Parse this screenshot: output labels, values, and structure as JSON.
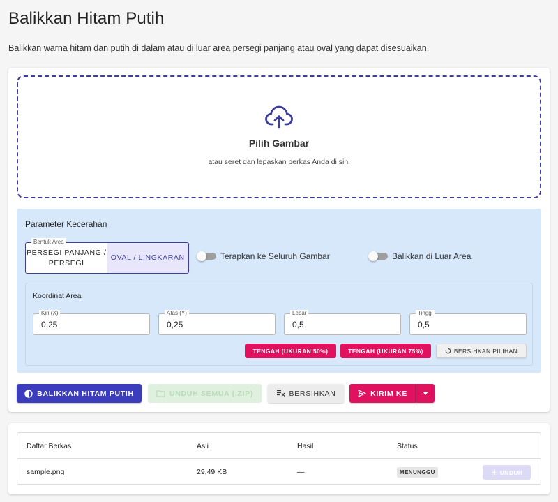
{
  "page": {
    "title": "Balikkan Hitam Putih",
    "description": "Balikkan warna hitam dan putih di dalam atau di luar area persegi panjang atau oval yang dapat disesuaikan."
  },
  "dropzone": {
    "icon": "cloud-upload-icon",
    "title": "Pilih Gambar",
    "subtitle": "atau seret dan lepaskan berkas Anda di sini"
  },
  "params": {
    "title": "Parameter Kecerahan",
    "shape": {
      "legend": "Bentuk Area",
      "options": [
        "PERSEGI PANJANG / PERSEGI",
        "OVAL / LINGKARAN"
      ],
      "selected": "OVAL / LINGKARAN"
    },
    "toggles": [
      {
        "label": "Terapkan ke Seluruh Gambar",
        "on": false
      },
      {
        "label": "Balikkan di Luar Area",
        "on": false
      }
    ],
    "coords": {
      "title": "Koordinat Area",
      "fields": [
        {
          "label": "Kiri (X)",
          "value": "0,25"
        },
        {
          "label": "Atas (Y)",
          "value": "0,25"
        },
        {
          "label": "Lebar",
          "value": "0,5"
        },
        {
          "label": "Tinggi",
          "value": "0,5"
        }
      ],
      "buttons": {
        "center50": "TENGAH (UKURAN 50%)",
        "center75": "TENGAH (UKURAN 75%)",
        "clear": "BERSIHKAN PILIHAN"
      }
    }
  },
  "actions": {
    "invert": "BALIKKAN HITAM PUTIH",
    "download_all": "UNDUH SEMUA (.ZIP)",
    "clear": "BERSIHKAN",
    "send_to": "KIRIM KE"
  },
  "files": {
    "headers": [
      "Daftar Berkas",
      "Asli",
      "Hasil",
      "Status"
    ],
    "rows": [
      {
        "name": "sample.png",
        "original": "29,49 KB",
        "result": "—",
        "status": "MENUNGGU",
        "action": "UNDUH"
      }
    ]
  },
  "colors": {
    "primary": "#3b3dbd",
    "accent": "#e0115f",
    "panel_bg": "#d7e8fa",
    "success_disabled": "#dff0df"
  }
}
